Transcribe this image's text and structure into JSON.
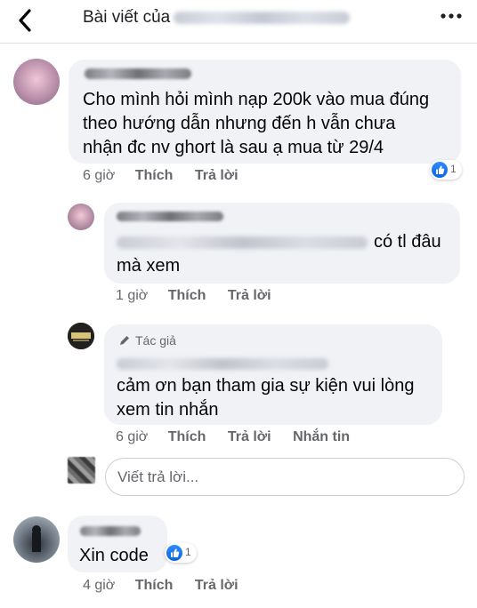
{
  "header": {
    "title": "Bài viết của"
  },
  "comments": [
    {
      "text_lines": [
        "Cho mình hỏi mình nạp 200k vào mua đúng",
        "theo hướng dẫn nhưng đến h vẫn chưa",
        "nhận đc nv ghort là sau ạ mua từ 29/4"
      ],
      "time": "6 giờ",
      "like_label": "Thích",
      "reply_label": "Trả lời",
      "reaction_count": "1"
    },
    {
      "text_line1_end": "có tl đâu",
      "text_line2": "mà xem",
      "time": "1 giờ",
      "like_label": "Thích",
      "reply_label": "Trả lời"
    },
    {
      "author_label": "Tác giả",
      "text_lines": [
        "cảm ơn bạn tham gia sự kiện vui lòng",
        "xem tin nhắn"
      ],
      "time": "6 giờ",
      "like_label": "Thích",
      "reply_label": "Trả lời",
      "message_label": "Nhắn tin"
    },
    {
      "text": "Xin code",
      "time": "4 giờ",
      "like_label": "Thích",
      "reply_label": "Trả lời",
      "reaction_count": "1"
    }
  ],
  "reply_box": {
    "placeholder": "Viết trả lời..."
  },
  "colors": {
    "bubble": "#f0f2f5",
    "secondary_text": "#65676b",
    "like_blue": "#1877f2"
  },
  "icons": {
    "back": "chevron-left-icon",
    "more": "more-dots-icon",
    "like": "like-thumb-icon",
    "author": "pencil-icon"
  }
}
